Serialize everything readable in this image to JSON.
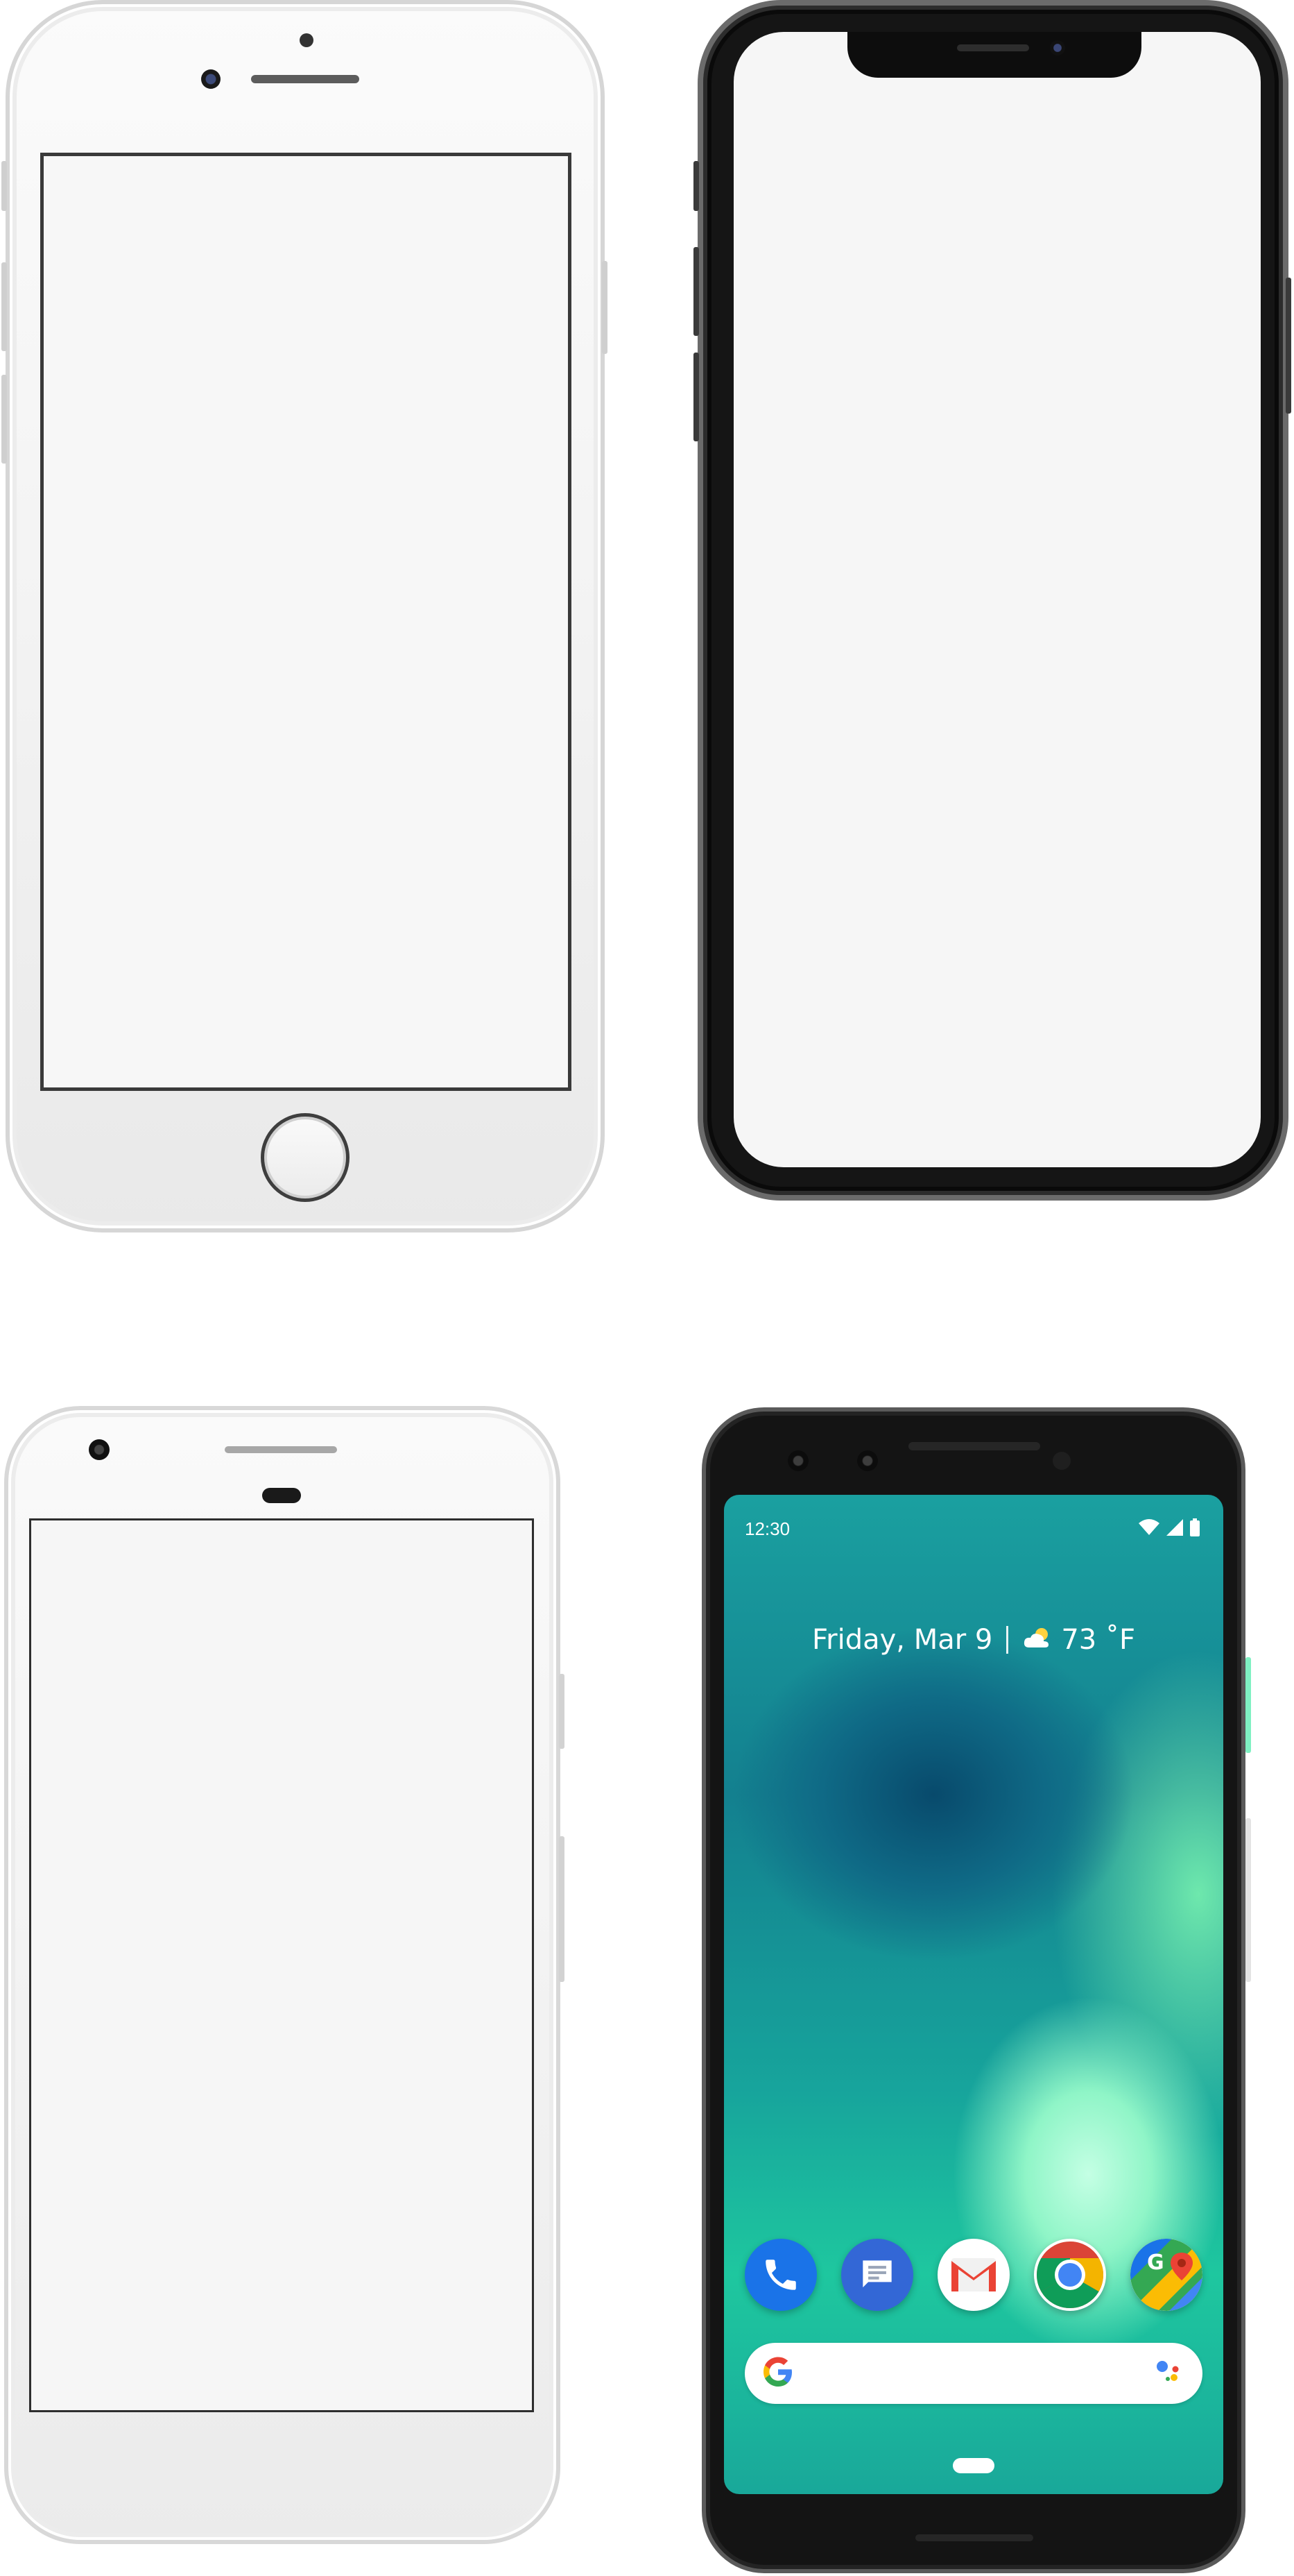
{
  "devices": [
    {
      "model": "iPhone 8",
      "finish": "silver"
    },
    {
      "model": "iPhone X",
      "finish": "space-gray"
    },
    {
      "model": "Pixel",
      "finish": "silver"
    },
    {
      "model": "Pixel 3",
      "finish": "just-black"
    }
  ],
  "pixel3_screen": {
    "status_bar": {
      "time": "12:30",
      "icons": [
        "wifi-icon",
        "signal-icon",
        "battery-icon"
      ]
    },
    "at_a_glance": {
      "date": "Friday, Mar 9",
      "weather_icon": "partly-cloudy-icon",
      "temperature": "73 ˚F"
    },
    "dock_apps": [
      {
        "name": "Phone",
        "icon": "phone-icon",
        "color": "#1a73e8"
      },
      {
        "name": "Messages",
        "icon": "messages-icon",
        "color": "#3367d6"
      },
      {
        "name": "Gmail",
        "icon": "gmail-icon",
        "color": "#ea4335"
      },
      {
        "name": "Chrome",
        "icon": "chrome-icon",
        "color": "#4285f4"
      },
      {
        "name": "Maps",
        "icon": "maps-icon",
        "color": "#34a853"
      }
    ],
    "search_bar": {
      "left_icon": "google-g-icon",
      "right_icon": "google-assistant-icon"
    },
    "colors": {
      "wallpaper_dark": "#084a6c",
      "wallpaper_light": "#c4ffe4",
      "accent_green": "#7ff0c2"
    }
  }
}
